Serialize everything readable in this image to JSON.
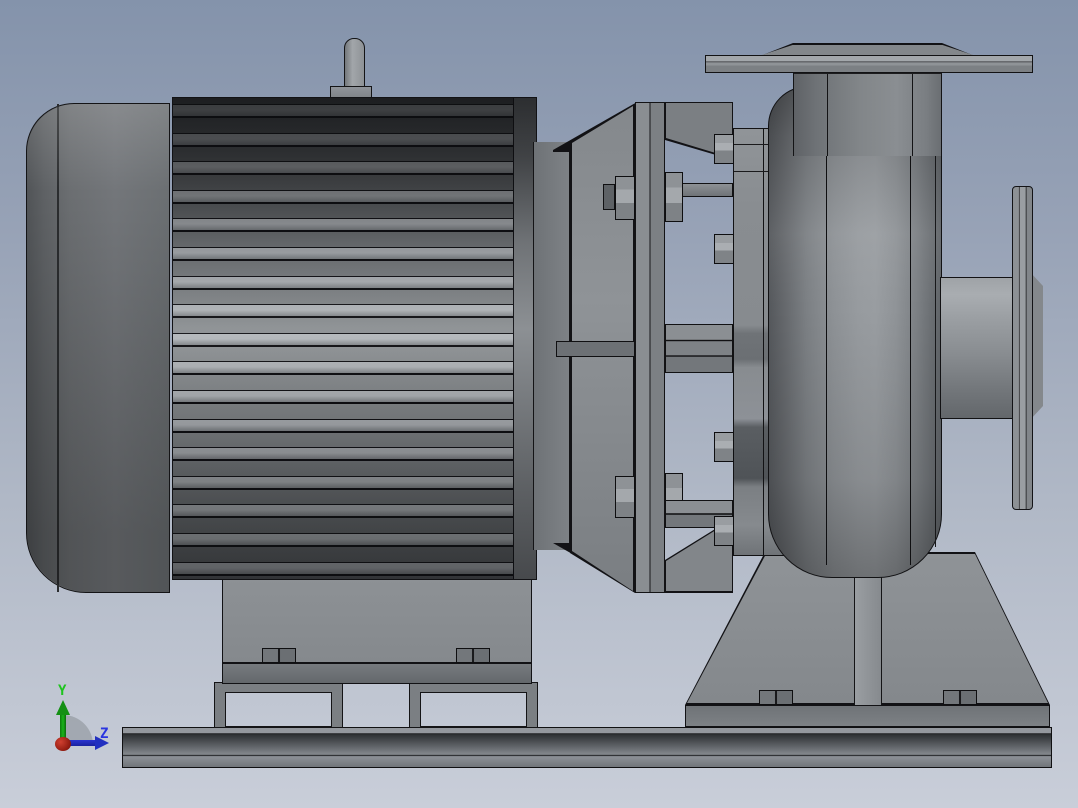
{
  "scene": {
    "description": "CAD side view render of a close-coupled centrifugal pump and electric motor mounted on a common baseplate",
    "background_top": "#8493ab",
    "background_bottom": "#c9ced9",
    "model_gray": "#8e9296",
    "outline_color": "#121215"
  },
  "triad": {
    "y_label": "Y",
    "z_label": "Z",
    "y_color": "#1ec41e",
    "z_color": "#2a35e0",
    "origin_color": "#b52b1d",
    "arc_color": "rgba(140,146,154,0.6)"
  },
  "model": {
    "motor": {
      "fin_count": 17
    },
    "parts": [
      "motor-end-cap",
      "motor-fin-housing",
      "lifting-eye",
      "motor-support-block",
      "motor-foot-frames",
      "lantern-bracket",
      "bracket-flange",
      "coupling-bolts",
      "pump-shaft",
      "pump-casing-cover",
      "cover-bolts",
      "volute-casing",
      "discharge-neck",
      "discharge-flange",
      "suction-pipe",
      "suction-flange",
      "pump-pedestal",
      "pedestal-rib",
      "anchor-bolts",
      "baseplate"
    ]
  }
}
